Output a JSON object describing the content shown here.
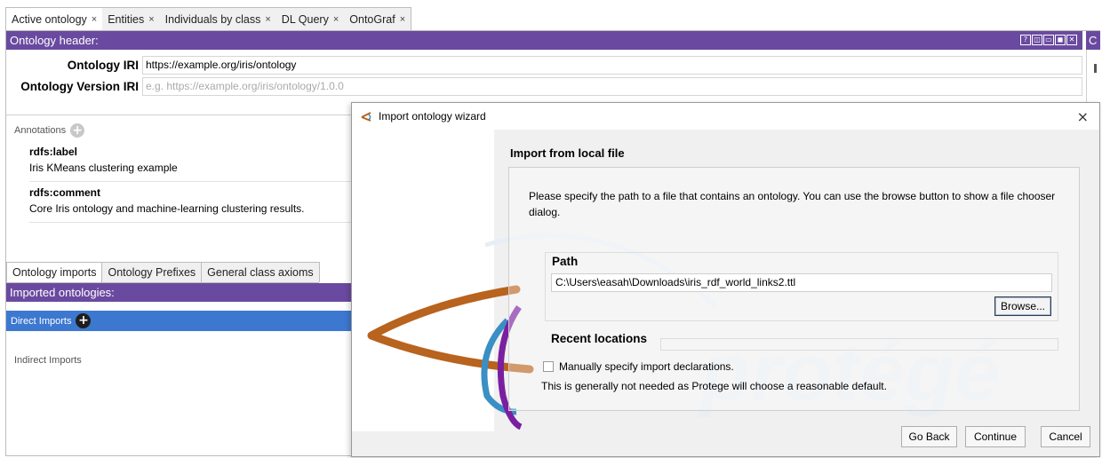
{
  "tabs": [
    {
      "label": "Active ontology",
      "close": "×"
    },
    {
      "label": "Entities",
      "close": "×"
    },
    {
      "label": "Individuals by class",
      "close": "×"
    },
    {
      "label": "DL Query",
      "close": "×"
    },
    {
      "label": "OntoGraf",
      "close": "×"
    }
  ],
  "header": {
    "title": "Ontology header:",
    "side_label": "C",
    "view_buttons": [
      "?",
      "◫",
      "▭",
      "◼",
      "✕"
    ]
  },
  "iri": {
    "label": "Ontology IRI",
    "value": "https://example.org/iris/ontology"
  },
  "version_iri": {
    "label": "Ontology Version IRI",
    "placeholder": "e.g. https://example.org/iris/ontology/1.0.0"
  },
  "annotations": {
    "header": "Annotations",
    "add_symbol": "+",
    "items": [
      {
        "property": "rdfs:label",
        "value": "Iris KMeans clustering example"
      },
      {
        "property": "rdfs:comment",
        "value": "Core Iris ontology and machine-learning clustering results."
      }
    ]
  },
  "imports_tabs": [
    "Ontology imports",
    "Ontology Prefixes",
    "General class axioms"
  ],
  "imported": {
    "title": "Imported ontologies:",
    "direct": "Direct Imports",
    "add_symbol": "+",
    "indirect": "Indirect Imports"
  },
  "dialog": {
    "title": "Import ontology wizard",
    "close": "×",
    "heading": "Import from local file",
    "instructions": "Please specify the path to a file that contains an ontology. You can use the browse button to show a file chooser dialog.",
    "path_label": "Path",
    "path_value": "C:\\Users\\easah\\Downloads\\iris_rdf_world_links2.ttl",
    "browse_label": "Browse...",
    "recent_label": "Recent locations",
    "manual_label": "Manually specify import declarations.",
    "manual_checked": false,
    "manual_note": "This is generally not needed as Protege will choose a reasonable default.",
    "watermark_text": "protégé",
    "buttons": {
      "back": "Go Back",
      "continue": "Continue",
      "cancel": "Cancel"
    },
    "colors": {
      "eye_orange": "#b8631e",
      "eye_blue": "#3a8fc4",
      "eye_purple": "#7a1fa0"
    }
  },
  "colors": {
    "purple_bar": "#6a4aa0",
    "selection_blue": "#3c78d0"
  }
}
